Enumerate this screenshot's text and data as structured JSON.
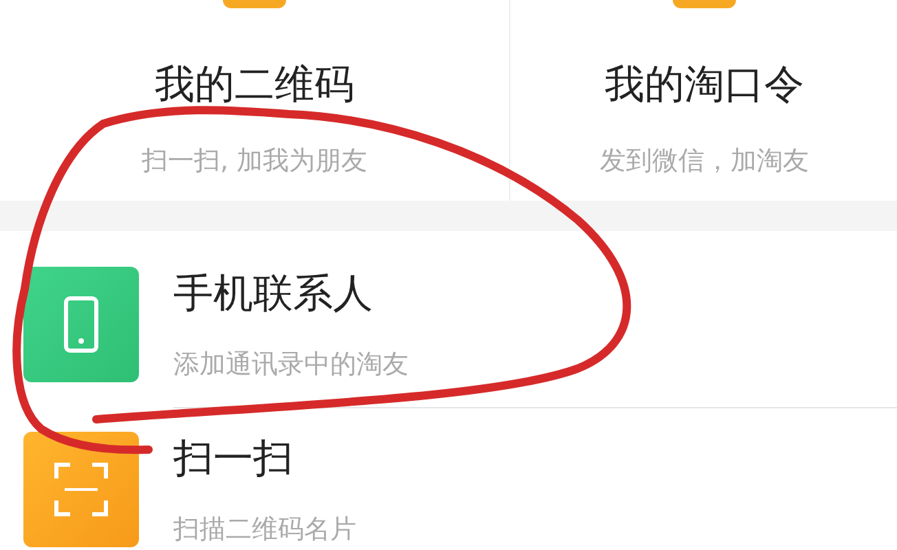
{
  "top_cards": [
    {
      "title": "我的二维码",
      "subtitle": "扫一扫, 加我为朋友"
    },
    {
      "title": "我的淘口令",
      "subtitle": "发到微信，加淘友"
    }
  ],
  "rows": [
    {
      "kind": "phone",
      "title": "手机联系人",
      "subtitle": "添加通讯录中的淘友"
    },
    {
      "kind": "scan",
      "title": "扫一扫",
      "subtitle": "扫描二维码名片"
    }
  ]
}
